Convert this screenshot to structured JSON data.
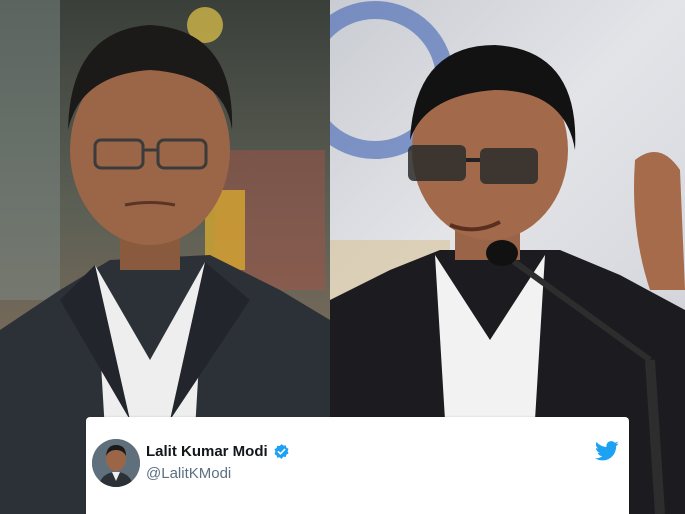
{
  "tweet": {
    "display_name": "Lalit Kumar Modi",
    "handle": "@LalitKModi",
    "verified": true,
    "brand_icon": "twitter-bird-icon",
    "verified_icon": "verified-badge-icon"
  },
  "photos": {
    "left": "portrait-man-glasses-dark-suit",
    "right": "portrait-man-glasses-microphone"
  },
  "colors": {
    "twitter_blue": "#1da1f2",
    "name_text": "#14171a",
    "handle_text": "#5b7083",
    "card_background": "#ffffff"
  }
}
